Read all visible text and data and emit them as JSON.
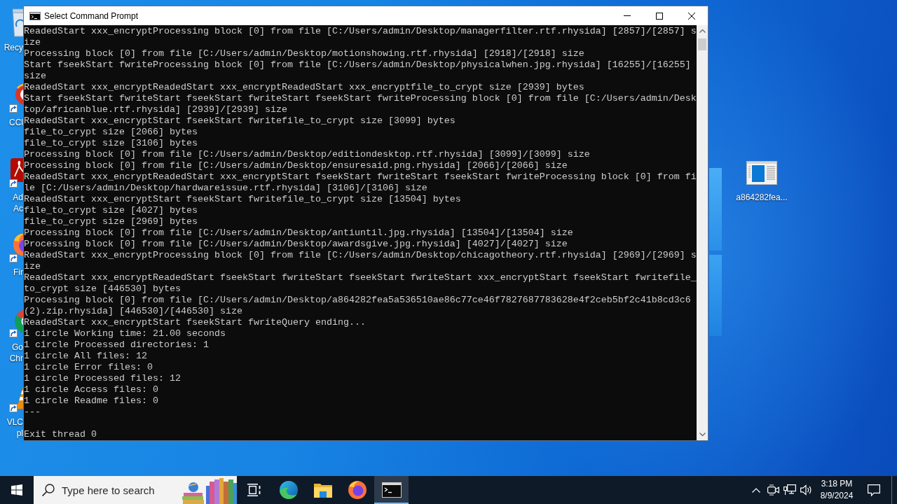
{
  "desktop": {
    "icons": [
      {
        "kind": "recycle_bin",
        "label": [
          "Recy"
        ]
      },
      {
        "kind": "ccleaner",
        "label": [
          "CCl"
        ]
      },
      {
        "kind": "acrobat",
        "label": [
          "Ad",
          "Ac"
        ]
      },
      {
        "kind": "firefox",
        "label": [
          "Fir"
        ]
      },
      {
        "kind": "chrome",
        "label": [
          "Go",
          "Chr"
        ]
      },
      {
        "kind": "vlc",
        "label": [
          "VLC",
          "pl"
        ]
      }
    ],
    "file_icon": {
      "label": "a864282fea..."
    }
  },
  "window": {
    "title": "Select Command Prompt",
    "console": {
      "sections": [
        {
          "lines": [
            "ReadedStart xxx_encryptProcessing block [0] from file [C:/Users/admin/Desktop/managerfilter.rtf.rhysida] [2857]/[2857] size",
            "Processing block [0] from file [C:/Users/admin/Desktop/motionshowing.rtf.rhysida] [2918]/[2918] size",
            "Start fseekStart fwriteProcessing block [0] from file [C:/Users/admin/Desktop/physicalwhen.jpg.rhysida] [16255]/[16255] size",
            "ReadedStart xxx_encryptReadedStart xxx_encryptReadedStart xxx_encryptfile_to_crypt size [2939] bytes",
            "Start fseekStart fwriteStart fseekStart fwriteStart fseekStart fwriteProcessing block [0] from file [C:/Users/admin/Desktop/africanblue.rtf.rhysida] [2939]/[2939] size",
            "ReadedStart xxx_encryptStart fseekStart fwritefile_to_crypt size [3099] bytes",
            "file_to_crypt size [2066] bytes",
            "file_to_crypt size [3106] bytes",
            "Processing block [0] from file [C:/Users/admin/Desktop/editiondesktop.rtf.rhysida] [3099]/[3099] size",
            "Processing block [0] from file [C:/Users/admin/Desktop/ensuresaid.png.rhysida] [2066]/[2066] size",
            "ReadedStart xxx_encryptReadedStart xxx_encryptStart fseekStart fwriteStart fseekStart fwriteProcessing block [0] from file [C:/Users/admin/Desktop/hardwareissue.rtf.rhysida] [3106]/[3106] size",
            "ReadedStart xxx_encryptStart fseekStart fwritefile_to_crypt size [13504] bytes",
            "file_to_crypt size [4027] bytes",
            "file_to_crypt size [2969] bytes",
            "Processing block [0] from file [C:/Users/admin/Desktop/antiuntil.jpg.rhysida] [13504]/[13504] size",
            "Processing block [0] from file [C:/Users/admin/Desktop/awardsgive.jpg.rhysida] [4027]/[4027] size",
            "ReadedStart xxx_encryptProcessing block [0] from file [C:/Users/admin/Desktop/chicagotheory.rtf.rhysida] [2969]/[2969] size",
            "ReadedStart xxx_encryptReadedStart fseekStart fwriteStart fseekStart fwriteStart xxx_encryptStart fseekStart fwritefile_to_crypt size [446530] bytes",
            "Processing block [0] from file [C:/Users/admin/Desktop/a864282fea5a536510ae86c77ce46f7827687783628e4f2ceb5bf2c41b8cd3c6 (2).zip.rhysida] [446530]/[446530] size",
            "ReadedStart xxx_encryptStart fseekStart fwriteQuery ending...",
            "1 circle Working time: 21.00 seconds",
            "1 circle Processed directories: 1",
            "1 circle All files: 12",
            "1 circle Error files: 0",
            "1 circle Processed files: 12",
            "1 circle Access files: 0",
            "1 circle Readme files: 0",
            "---"
          ]
        },
        {
          "lines": [
            "Exit thread 0"
          ]
        }
      ]
    }
  },
  "taskbar": {
    "search": {
      "placeholder": "Type here to search"
    },
    "apps": [
      {
        "kind": "task_view",
        "active": false
      },
      {
        "kind": "edge",
        "active": false
      },
      {
        "kind": "file_explorer",
        "active": false
      },
      {
        "kind": "firefox",
        "active": false
      },
      {
        "kind": "command_prompt",
        "active": true
      }
    ],
    "clock": {
      "time": "3:18 PM",
      "date": "8/9/2024"
    }
  }
}
